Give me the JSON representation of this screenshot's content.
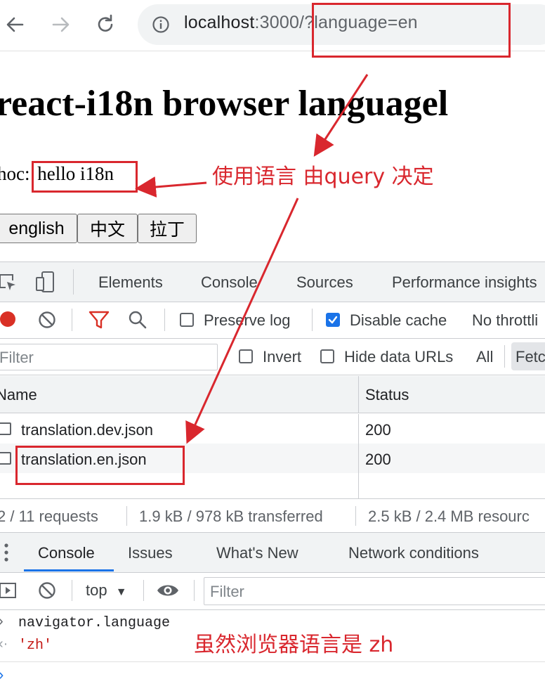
{
  "browser": {
    "url_host": "localhost",
    "url_port": ":3000",
    "url_query": "/?language=en"
  },
  "page": {
    "heading": "react-i18n browser languagel",
    "hoc_prefix": "hoc:",
    "hoc_text": "hello i18n",
    "buttons": [
      "english",
      "中文",
      "拉丁"
    ]
  },
  "devtools": {
    "tabs": [
      "Elements",
      "Console",
      "Sources",
      "Performance insights"
    ],
    "preserve_log": "Preserve log",
    "disable_cache": "Disable cache",
    "throttling": "No throttli",
    "filter_placeholder": "Filter",
    "invert": "Invert",
    "hide_data_urls": "Hide data URLs",
    "all": "All",
    "fetch": "Fetc",
    "table": {
      "headers": [
        "Name",
        "Status"
      ],
      "rows": [
        {
          "name": "translation.dev.json",
          "status": "200"
        },
        {
          "name": "translation.en.json",
          "status": "200"
        }
      ]
    },
    "status": {
      "requests": "2 / 11 requests",
      "transferred": "1.9 kB / 978 kB transferred",
      "resources": "2.5 kB / 2.4 MB resourc"
    },
    "drawer_tabs": [
      "Console",
      "Issues",
      "What's New",
      "Network conditions"
    ],
    "console": {
      "context": "top",
      "filter_placeholder": "Filter",
      "input": "navigator.language",
      "output": "'zh'"
    }
  },
  "annotations": {
    "query_note": "使用语言 由query 决定",
    "browser_note": "虽然浏览器语言是 zh",
    "color": "#d9272e"
  }
}
